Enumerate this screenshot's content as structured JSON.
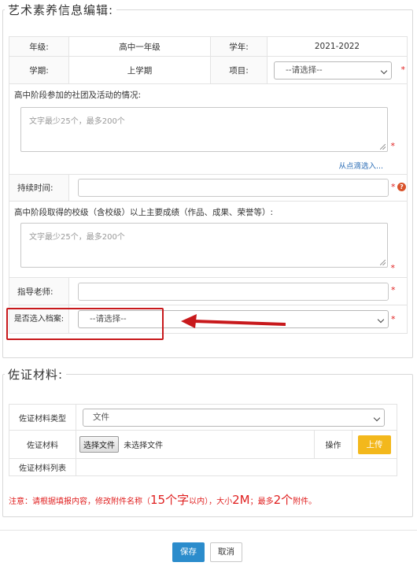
{
  "section1": {
    "title": "艺术素养信息编辑:",
    "grade_label": "年级:",
    "grade_value": "高中一年级",
    "year_label": "学年:",
    "year_value": "2021-2022",
    "term_label": "学期:",
    "term_value": "上学期",
    "project_label": "项目:",
    "project_select": "--请选择--",
    "clubs_label": "高中阶段参加的社团及活动的情况:",
    "clubs_placeholder": "文字最少25个，最多200个",
    "pick_link": "从点滴选入...",
    "duration_label": "持续时间:",
    "achievements_label": "高中阶段取得的校级（含校级）以上主要成绩（作品、成果、荣誉等）:",
    "achievements_placeholder": "文字最少25个，最多200个",
    "teacher_label": "指导老师:",
    "archive_label": "是否选入档案:",
    "archive_select": "--请选择--",
    "required_mark": "*",
    "help_icon": "?"
  },
  "section2": {
    "title": "佐证材料:",
    "type_label": "佐证材料类型",
    "type_value": "文件",
    "material_label": "佐证材料",
    "choose_file": "选择文件",
    "no_file": "未选择文件",
    "op_label": "操作",
    "upload": "上传",
    "list_label": "佐证材料列表"
  },
  "notice": {
    "p1": "注意：请根据填报内容，修改附件名称（",
    "n1": "15个字",
    "p2": "以内），大小",
    "n2": "2M",
    "p3": "；最多",
    "n3": "2个",
    "p4": "附件。"
  },
  "footer": {
    "save": "保存",
    "cancel": "取消"
  },
  "colors": {
    "accent_blue": "#2b8ccc",
    "upload_yellow": "#f3b81c",
    "required_red": "#e02020",
    "highlight_red": "#c8191c"
  }
}
